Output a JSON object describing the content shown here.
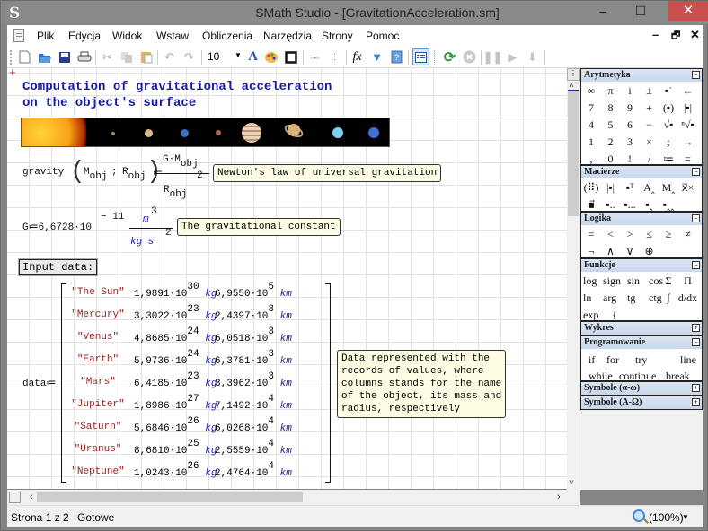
{
  "window": {
    "title": "SMath Studio - [GravitationAcceleration.sm]",
    "app_icon": "S",
    "controls": {
      "minimize": "–",
      "maximize": "☐",
      "close": "✕"
    }
  },
  "menubar": {
    "items": [
      "Plik",
      "Edycja",
      "Widok",
      "Wstaw",
      "Obliczenia",
      "Narzędzia",
      "Strony",
      "Pomoc"
    ],
    "mdi_controls": {
      "minimize": "–",
      "restore": "🗗",
      "close": "✕"
    }
  },
  "toolbar": {
    "font_size": "10",
    "icons": [
      "new-icon",
      "open-icon",
      "save-icon",
      "print-icon",
      "cut-icon",
      "copy-icon",
      "paste-icon",
      "undo-icon",
      "redo-icon",
      "font-size-select",
      "text-color-icon",
      "fill-color-icon",
      "border-icon",
      "align-horizontal-icon",
      "align-vertical-icon",
      "function-icon",
      "filter-icon",
      "help-icon",
      "panel-toggle-icon",
      "recalculate-icon",
      "stop-icon",
      "pause-icon",
      "play-icon",
      "step-icon"
    ]
  },
  "document": {
    "heading_line1": "Computation of gravitational acceleration",
    "heading_line2": "on the object's surface",
    "gravity_def": {
      "name": "gravity",
      "arg1": "M",
      "arg1_sub": "obj",
      "sep": ";",
      "arg2": "R",
      "arg2_sub": "obj",
      "assign": "≔",
      "num": "G·M",
      "num_sub": "obj",
      "den": "R",
      "den_sub": "obj",
      "den_exp": "2",
      "note": "Newton's law of universal gravitation"
    },
    "G_def": {
      "lhs": "G≔6,6728·10",
      "exp": "− 11",
      "unit_num": "m",
      "unit_num_exp": "3",
      "unit_den": "kg s",
      "unit_den_exp": "2",
      "note": "The gravitational constant"
    },
    "input_label": "Input data:",
    "data_label": "data≔",
    "matrix": [
      {
        "name": "\"The Sun\"",
        "mass": "1,9891·10",
        "mass_exp": "30",
        "mass_unit": "kg",
        "radius": "6,9550·10",
        "radius_exp": "5",
        "radius_unit": "km"
      },
      {
        "name": "\"Mercury\"",
        "mass": "3,3022·10",
        "mass_exp": "23",
        "mass_unit": "kg",
        "radius": "2,4397·10",
        "radius_exp": "3",
        "radius_unit": "km"
      },
      {
        "name": "\"Venus\"",
        "mass": "4,8685·10",
        "mass_exp": "24",
        "mass_unit": "kg",
        "radius": "6,0518·10",
        "radius_exp": "3",
        "radius_unit": "km"
      },
      {
        "name": "\"Earth\"",
        "mass": "5,9736·10",
        "mass_exp": "24",
        "mass_unit": "kg",
        "radius": "6,3781·10",
        "radius_exp": "3",
        "radius_unit": "km"
      },
      {
        "name": "\"Mars\"",
        "mass": "6,4185·10",
        "mass_exp": "23",
        "mass_unit": "kg",
        "radius": "3,3962·10",
        "radius_exp": "3",
        "radius_unit": "km"
      },
      {
        "name": "\"Jupiter\"",
        "mass": "1,8986·10",
        "mass_exp": "27",
        "mass_unit": "kg",
        "radius": "7,1492·10",
        "radius_exp": "4",
        "radius_unit": "km"
      },
      {
        "name": "\"Saturn\"",
        "mass": "5,6846·10",
        "mass_exp": "26",
        "mass_unit": "kg",
        "radius": "6,0268·10",
        "radius_exp": "4",
        "radius_unit": "km"
      },
      {
        "name": "\"Uranus\"",
        "mass": "8,6810·10",
        "mass_exp": "25",
        "mass_unit": "kg",
        "radius": "2,5559·10",
        "radius_exp": "4",
        "radius_unit": "km"
      },
      {
        "name": "\"Neptune\"",
        "mass": "1,0243·10",
        "mass_exp": "26",
        "mass_unit": "kg",
        "radius": "2,4764·10",
        "radius_exp": "4",
        "radius_unit": "km"
      }
    ],
    "data_note": "Data represented with the\nrecords of values, where\ncolumns stands for the name\nof the object, its mass and\nradius, respectively"
  },
  "side_panel": {
    "arytmetyka": {
      "title": "Arytmetyka",
      "toggle": "−",
      "rows": [
        [
          "∞",
          "π",
          "i",
          "±",
          "▪˙",
          "←"
        ],
        [
          "7",
          "8",
          "9",
          "+",
          "(▪)",
          "|▪|"
        ],
        [
          "4",
          "5",
          "6",
          "−",
          "√▪",
          "ⁿ√▪"
        ],
        [
          "1",
          "2",
          "3",
          "×",
          ";",
          "→"
        ],
        [
          ",",
          "0",
          "!",
          "/",
          "≔",
          "="
        ]
      ]
    },
    "macierze": {
      "title": "Macierze",
      "toggle": "−",
      "rows": [
        [
          "(⠿)",
          "|▪|",
          "▪ᵀ",
          "A‸",
          "M‸",
          "x⃗×"
        ],
        [
          "▪⃗",
          "▪..",
          "▪...",
          "▪‸",
          "▪‸‸"
        ]
      ]
    },
    "logika": {
      "title": "Logika",
      "toggle": "−",
      "rows": [
        [
          "=",
          "<",
          ">",
          "≤",
          "≥",
          "≠"
        ],
        [
          "¬",
          "∧",
          "∨",
          "⊕"
        ]
      ]
    },
    "funkcje": {
      "title": "Funkcje",
      "toggle": "−",
      "rows": [
        [
          "log",
          "sign",
          "sin",
          "cos",
          "Σ",
          "Π"
        ],
        [
          "ln",
          "arg",
          "tg",
          "ctg",
          "∫",
          "d/dx"
        ],
        [
          "exp",
          "{"
        ]
      ]
    },
    "wykres": {
      "title": "Wykres",
      "toggle": "+"
    },
    "programowanie": {
      "title": "Programowanie",
      "toggle": "−",
      "rows": [
        [
          "if",
          "for",
          "try",
          "line"
        ],
        [
          "while",
          "continue",
          "break"
        ]
      ]
    },
    "symbole_lower": {
      "title": "Symbole (α-ω)",
      "toggle": "+"
    },
    "symbole_upper": {
      "title": "Symbole (Α-Ω)",
      "toggle": "+"
    }
  },
  "statusbar": {
    "page": "Strona 1 z 2",
    "state": "Gotowe",
    "zoom": "(100%)"
  }
}
